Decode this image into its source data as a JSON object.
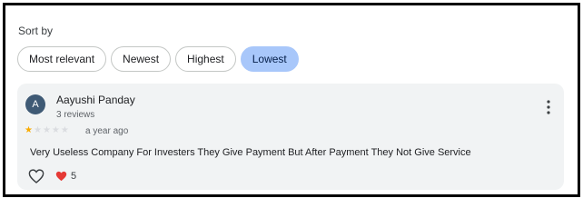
{
  "sort": {
    "label": "Sort by",
    "options": [
      {
        "label": "Most relevant",
        "selected": false
      },
      {
        "label": "Newest",
        "selected": false
      },
      {
        "label": "Highest",
        "selected": false
      },
      {
        "label": "Lowest",
        "selected": true
      }
    ]
  },
  "review": {
    "author_initial": "A",
    "author_name": "Aayushi Panday",
    "author_reviews": "3 reviews",
    "rating": 1,
    "rating_max": 5,
    "time": "a year ago",
    "text": "Very Useless Company For Investers They Give Payment But After Payment They Not Give Service",
    "reaction_count": "5"
  },
  "colors": {
    "selected_chip": "#a8c7fa",
    "avatar": "#3f5a75",
    "star_filled": "#f9ab00",
    "heart": "#e53935"
  },
  "icons": {
    "more": "more-vert-icon",
    "like": "heart-outline-icon",
    "reaction": "heart-filled-icon"
  }
}
